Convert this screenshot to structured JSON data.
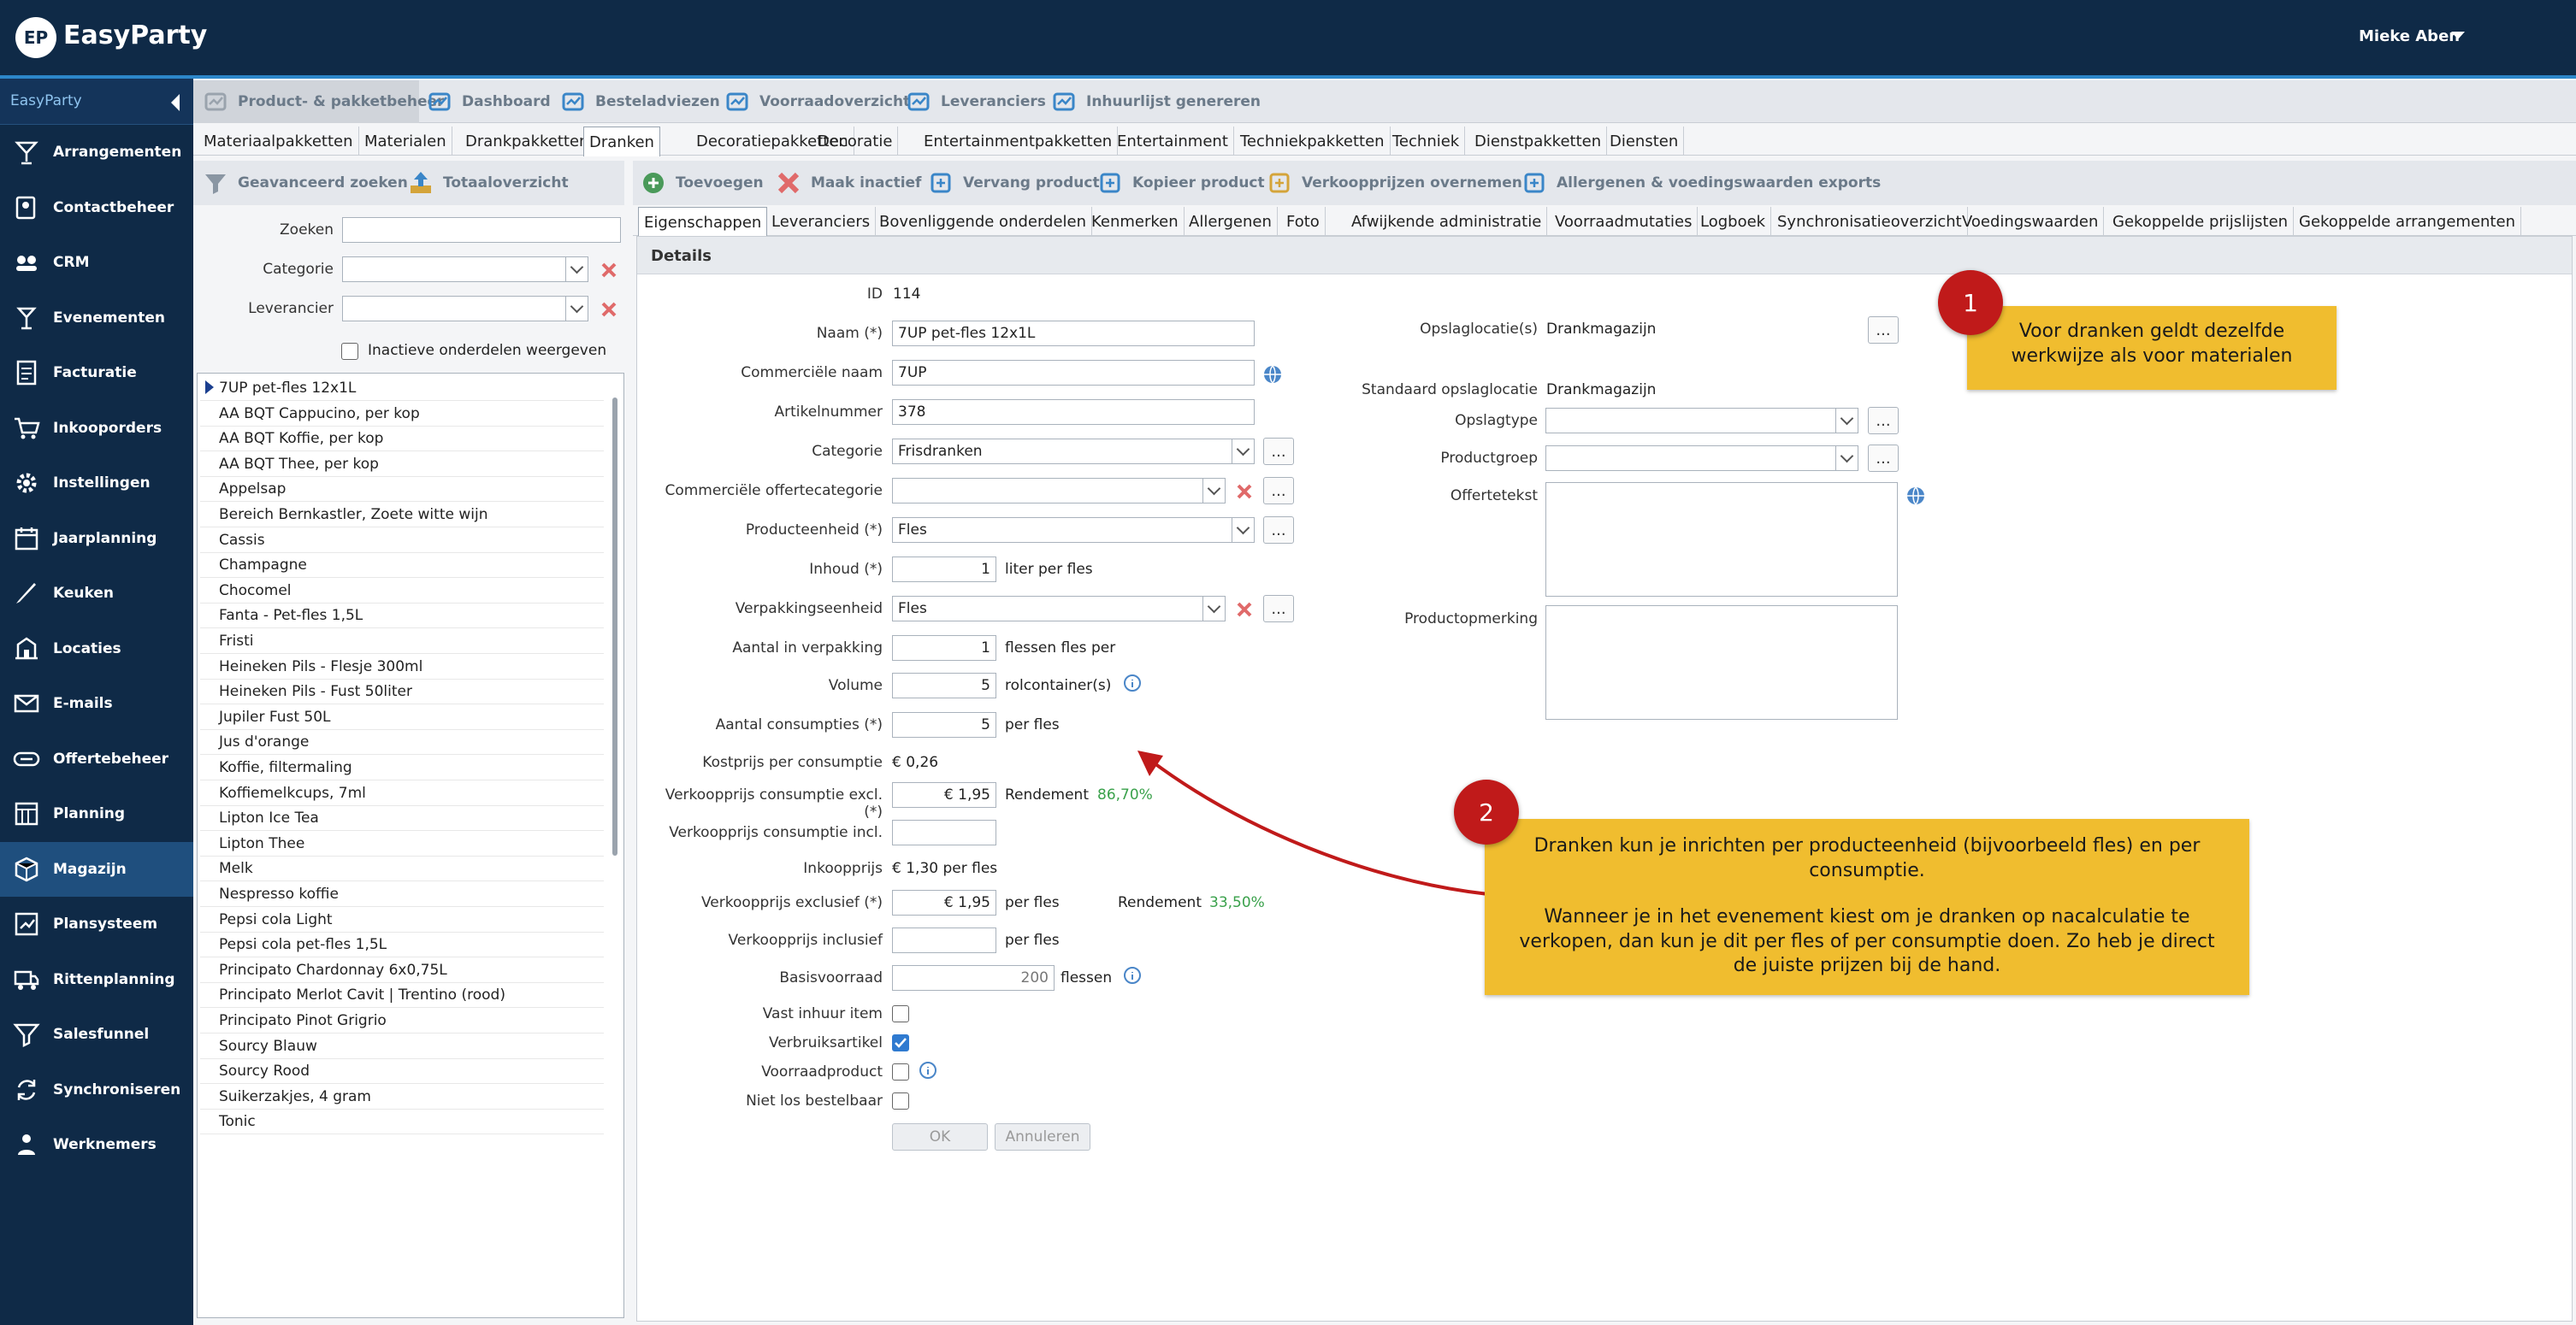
{
  "app": {
    "name": "EasyParty",
    "logo_badge": "EP",
    "user": "Mieke Aben"
  },
  "sidebar": {
    "header": "EasyParty",
    "items": [
      {
        "label": "Arrangementen",
        "icon": "cocktail-icon"
      },
      {
        "label": "Contactbeheer",
        "icon": "contacts-icon"
      },
      {
        "label": "CRM",
        "icon": "crm-icon"
      },
      {
        "label": "Evenementen",
        "icon": "event-icon"
      },
      {
        "label": "Facturatie",
        "icon": "invoice-icon"
      },
      {
        "label": "Inkooporders",
        "icon": "cart-icon"
      },
      {
        "label": "Instellingen",
        "icon": "gear-icon"
      },
      {
        "label": "Jaarplanning",
        "icon": "calendar-icon"
      },
      {
        "label": "Keuken",
        "icon": "knife-icon"
      },
      {
        "label": "Locaties",
        "icon": "building-icon"
      },
      {
        "label": "E-mails",
        "icon": "mail-icon"
      },
      {
        "label": "Offertebeheer",
        "icon": "quote-icon"
      },
      {
        "label": "Planning",
        "icon": "planning-icon"
      },
      {
        "label": "Magazijn",
        "icon": "box-icon"
      },
      {
        "label": "Plansysteem",
        "icon": "plan-icon"
      },
      {
        "label": "Rittenplanning",
        "icon": "truck-icon"
      },
      {
        "label": "Salesfunnel",
        "icon": "funnel-icon"
      },
      {
        "label": "Synchroniseren",
        "icon": "sync-icon"
      },
      {
        "label": "Werknemers",
        "icon": "people-icon"
      }
    ],
    "active": "Magazijn"
  },
  "toolbar": {
    "items": [
      "Product- & pakketbeheer",
      "Dashboard",
      "Besteladviezen",
      "Voorraadoverzicht",
      "Leveranciers",
      "Inhuurlijst genereren"
    ]
  },
  "category_tabs": [
    "Materiaalpakketten",
    "Materialen",
    "Drankpakketten",
    "Dranken",
    "Decoratiepakketten",
    "Decoratie",
    "Entertainmentpakketten",
    "Entertainment",
    "Techniekpakketten",
    "Techniek",
    "Dienstpakketten",
    "Diensten"
  ],
  "left_panel": {
    "toolbar": [
      "Geavanceerd zoeken",
      "Totaaloverzicht"
    ],
    "search_label": "Zoeken",
    "category_label": "Categorie",
    "supplier_label": "Leverancier",
    "inactive_label": "Inactieve onderdelen weergeven",
    "items": [
      "7UP pet-fles 12x1L",
      "AA BQT Cappucino, per kop",
      "AA BQT Koffie, per kop",
      "AA BQT Thee, per kop",
      "Appelsap",
      "Bereich Bernkastler, Zoete witte wijn",
      "Cassis",
      "Champagne",
      "Chocomel",
      "Fanta - Pet-fles 1,5L",
      "Fristi",
      "Heineken Pils - Flesje 300ml",
      "Heineken Pils - Fust 50liter",
      "Jupiler Fust 50L",
      "Jus d'orange",
      "Koffie, filtermaling",
      "Koffiemelkcups, 7ml",
      "Lipton Ice Tea",
      "Lipton Thee",
      "Melk",
      "Nespresso koffie",
      "Pepsi cola Light",
      "Pepsi cola pet-fles 1,5L",
      "Principato Chardonnay 6x0,75L",
      "Principato Merlot Cavit | Trentino (rood)",
      "Principato Pinot Grigrio",
      "Sourcy Blauw",
      "Sourcy Rood",
      "Suikerzakjes, 4 gram",
      "Tonic"
    ]
  },
  "action_toolbar": [
    "Toevoegen",
    "Maak inactief",
    "Vervang product",
    "Kopieer product",
    "Verkoopprijzen overnemen",
    "Allergenen & voedingswaarden exports"
  ],
  "detail_tabs": [
    "Eigenschappen",
    "Leveranciers",
    "Bovenliggende onderdelen",
    "Kenmerken",
    "Allergenen",
    "Foto",
    "Afwijkende administratie",
    "Voorraadmutaties",
    "Logboek",
    "Synchronisatieoverzicht",
    "Voedingswaarden",
    "Gekoppelde prijslijsten",
    "Gekoppelde arrangementen"
  ],
  "details": {
    "header": "Details",
    "id_label": "ID",
    "id": "114",
    "naam_label": "Naam (*)",
    "naam": "7UP pet-fles 12x1L",
    "comm_naam_label": "Commerciële naam",
    "comm_naam": "7UP",
    "artikel_label": "Artikelnummer",
    "artikel": "378",
    "categorie_label": "Categorie",
    "categorie": "Frisdranken",
    "comm_offerte_label": "Commerciële offertecategorie",
    "comm_offerte": "",
    "producteenheid_label": "Producteenheid (*)",
    "producteenheid": "Fles",
    "inhoud_label": "Inhoud (*)",
    "inhoud": "1",
    "inhoud_unit": "liter  per fles",
    "verpakking_label": "Verpakkingseenheid",
    "verpakking": "Fles",
    "aantal_verp_label": "Aantal in verpakking",
    "aantal_verp": "1",
    "aantal_verp_unit": "flessen fles per",
    "volume_label": "Volume",
    "volume": "5",
    "volume_unit": "rolcontainer(s)",
    "aantal_cons_label": "Aantal consumpties (*)",
    "aantal_cons": "5",
    "aantal_cons_unit": "per  fles",
    "kostprijs_label": "Kostprijs per consumptie",
    "kostprijs": "€ 0,26",
    "vp_cons_excl_label": "Verkoopprijs consumptie excl. (*)",
    "vp_cons_excl": "€ 1,95",
    "rendement_label": "Rendement",
    "rendement_cons": "86,70%",
    "vp_cons_incl_label": "Verkoopprijs consumptie incl.",
    "vp_cons_incl": "",
    "inkoopprijs_label": "Inkoopprijs",
    "inkoopprijs": "€ 1,30 per fles",
    "vp_excl_label": "Verkoopprijs exclusief (*)",
    "vp_excl": "€ 1,95",
    "per_fles": "per fles",
    "rendement_fles": "33,50%",
    "vp_incl_label": "Verkoopprijs inclusief",
    "vp_incl": "",
    "basis_label": "Basisvoorraad",
    "basis": "200",
    "basis_unit": "flessen",
    "vast_inhuur_label": "Vast inhuur item",
    "verbruik_label": "Verbruiksartikel",
    "voorraad_label": "Voorraadproduct",
    "niet_los_label": "Niet los bestelbaar",
    "ok": "OK",
    "annuleren": "Annuleren",
    "opslaglocaties_label": "Opslaglocatie(s)",
    "opslaglocaties": "Drankmagazijn",
    "std_opslag_label": "Standaard opslaglocatie",
    "std_opslag": "Drankmagazijn",
    "opslagtype_label": "Opslagtype",
    "productgroep_label": "Productgroep",
    "offertetekst_label": "Offertetekst",
    "productopmerking_label": "Productopmerking",
    "dots": "..."
  },
  "annotations": {
    "badge1": "1",
    "callout1": "Voor dranken geldt dezelfde werkwijze als voor materialen",
    "badge2": "2",
    "callout2_p1": "Dranken kun je inrichten per producteenheid (bijvoorbeeld fles) en per consumptie.",
    "callout2_p2": "Wanneer je in het evenement kiest om je dranken op nacalculatie te verkopen, dan kun je dit per fles of per consumptie doen. Zo heb je direct de juiste prijzen bij de hand."
  },
  "colors": {
    "navy": "#0f2a47",
    "accent": "#2c86c9",
    "callout": "#f0bd2f",
    "badge": "#c01a1a",
    "green": "#3aa14b"
  }
}
